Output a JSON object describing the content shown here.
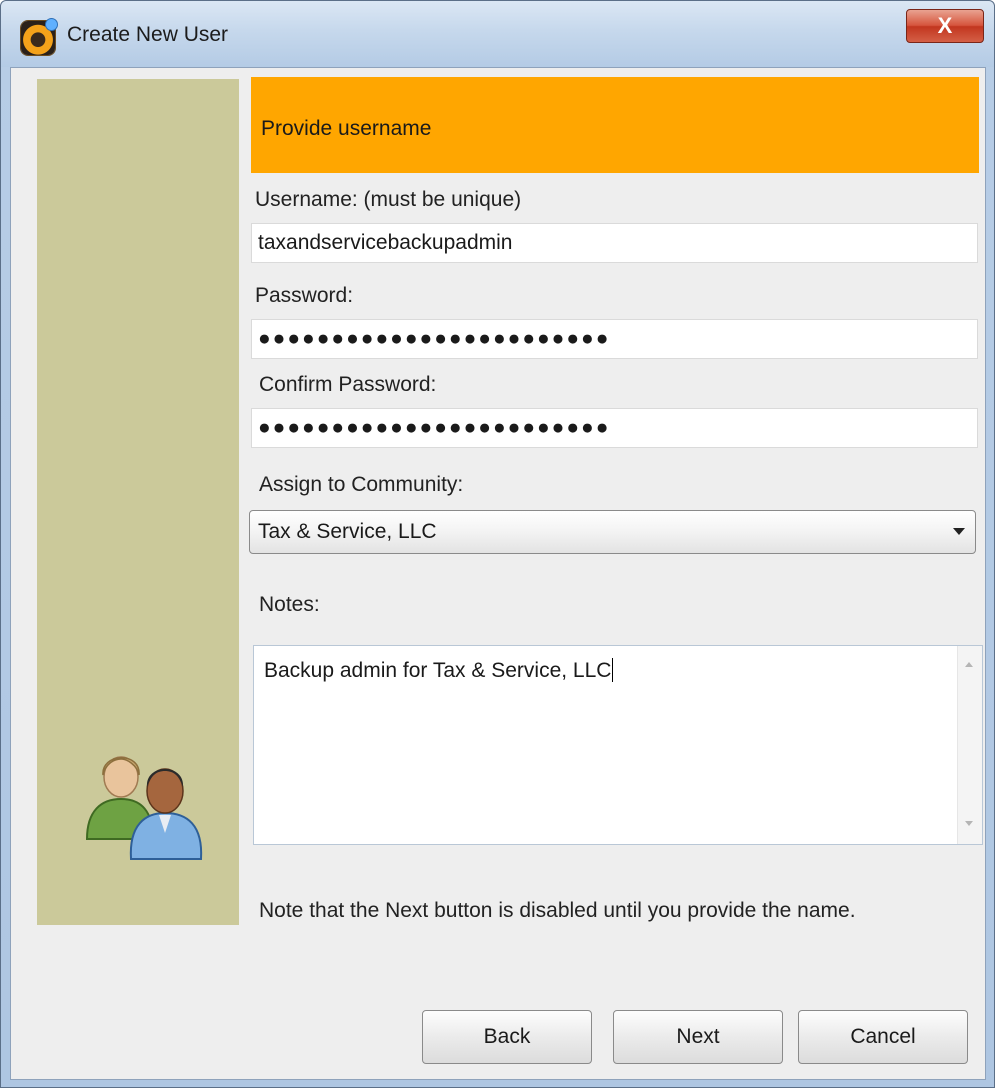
{
  "window": {
    "title": "Create New User",
    "close_glyph": "X"
  },
  "header": {
    "title": "Provide username",
    "color": "#ffa600"
  },
  "side_panel": {
    "color": "#cbc99a",
    "icon": "users-icon"
  },
  "form": {
    "username_label": "Username: (must be unique)",
    "username_value": "taxandservicebackupadmin",
    "password_label": "Password:",
    "password_value": "●●●●●●●●●●●●●●●●●●●●●●●●",
    "confirm_label": "Confirm Password:",
    "confirm_value": "●●●●●●●●●●●●●●●●●●●●●●●●",
    "community_label": "Assign to Community:",
    "community_selected": "Tax & Service, LLC",
    "notes_label": "Notes:",
    "notes_value": "Backup admin for Tax & Service, LLC"
  },
  "hint": "Note that the Next button is disabled until you provide the name.",
  "buttons": {
    "back": "Back",
    "next": "Next",
    "cancel": "Cancel"
  }
}
